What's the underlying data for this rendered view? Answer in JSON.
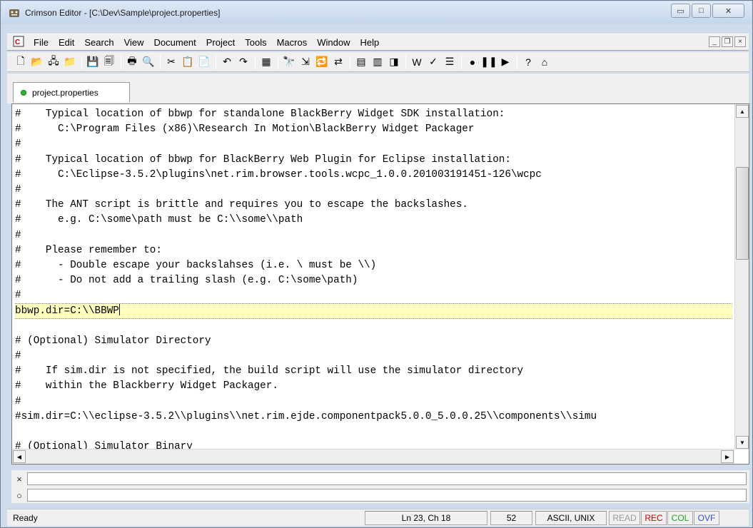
{
  "window": {
    "title": "Crimson Editor - [C:\\Dev\\Sample\\project.properties]",
    "controls": {
      "minimize": "▭",
      "maximize": "□",
      "close": "✕"
    }
  },
  "menubar": {
    "items": [
      "File",
      "Edit",
      "Search",
      "View",
      "Document",
      "Project",
      "Tools",
      "Macros",
      "Window",
      "Help"
    ],
    "mdi": {
      "minimize": "_",
      "restore": "❐",
      "close": "×"
    }
  },
  "toolbar": {
    "buttons": [
      {
        "name": "new-file",
        "glyph": "🗋"
      },
      {
        "name": "open-file",
        "glyph": "📂"
      },
      {
        "name": "open-remote",
        "glyph": "🖧"
      },
      {
        "name": "open-folder",
        "glyph": "📁"
      },
      {
        "sep": true
      },
      {
        "name": "save",
        "glyph": "💾"
      },
      {
        "name": "save-all",
        "glyph": "🗐"
      },
      {
        "sep": true
      },
      {
        "name": "print",
        "glyph": "🖶"
      },
      {
        "name": "print-preview",
        "glyph": "🔍"
      },
      {
        "sep": true
      },
      {
        "name": "cut",
        "glyph": "✂"
      },
      {
        "name": "copy",
        "glyph": "📋"
      },
      {
        "name": "paste",
        "glyph": "📄"
      },
      {
        "sep": true
      },
      {
        "name": "undo",
        "glyph": "↶"
      },
      {
        "name": "redo",
        "glyph": "↷"
      },
      {
        "sep": true
      },
      {
        "name": "column-mode",
        "glyph": "▦"
      },
      {
        "sep": true
      },
      {
        "name": "find",
        "glyph": "🔭"
      },
      {
        "name": "find-next",
        "glyph": "⇲"
      },
      {
        "name": "replace",
        "glyph": "🔁"
      },
      {
        "name": "replace-next",
        "glyph": "⇄"
      },
      {
        "sep": true
      },
      {
        "name": "toggle-output",
        "glyph": "▤"
      },
      {
        "name": "toggle-tabs",
        "glyph": "▥"
      },
      {
        "name": "toggle-directory",
        "glyph": "◨"
      },
      {
        "sep": true
      },
      {
        "name": "word-wrap",
        "glyph": "W"
      },
      {
        "name": "spell-check",
        "glyph": "✓"
      },
      {
        "name": "line-numbers",
        "glyph": "☰"
      },
      {
        "sep": true
      },
      {
        "name": "record-macro",
        "glyph": "●"
      },
      {
        "name": "pause-macro",
        "glyph": "❚❚"
      },
      {
        "name": "play-macro",
        "glyph": "▶"
      },
      {
        "sep": true
      },
      {
        "name": "help",
        "glyph": "?"
      },
      {
        "name": "home",
        "glyph": "⌂"
      }
    ]
  },
  "tab": {
    "label": "project.properties"
  },
  "editor": {
    "lines": [
      "#    Typical location of bbwp for standalone BlackBerry Widget SDK installation:",
      "#      C:\\Program Files (x86)\\Research In Motion\\BlackBerry Widget Packager",
      "#",
      "#    Typical location of bbwp for BlackBerry Web Plugin for Eclipse installation:",
      "#      C:\\Eclipse-3.5.2\\plugins\\net.rim.browser.tools.wcpc_1.0.0.201003191451-126\\wcpc",
      "#",
      "#    The ANT script is brittle and requires you to escape the backslashes.",
      "#      e.g. C:\\some\\path must be C:\\\\some\\\\path",
      "#",
      "#    Please remember to:",
      "#      - Double escape your backslahses (i.e. \\ must be \\\\)",
      "#      - Do not add a trailing slash (e.g. C:\\some\\path)",
      "#",
      "bbwp.dir=C:\\\\BBWP",
      "",
      "# (Optional) Simulator Directory",
      "#",
      "#    If sim.dir is not specified, the build script will use the simulator directory",
      "#    within the Blackberry Widget Packager.",
      "#",
      "#sim.dir=C:\\\\eclipse-3.5.2\\\\plugins\\\\net.rim.ejde.componentpack5.0.0_5.0.0.25\\\\components\\\\simu",
      "",
      "# (Optional) Simulator Binary"
    ],
    "current_line_index": 13
  },
  "panes": {
    "output_label": "×",
    "command_label": "○"
  },
  "status": {
    "ready": "Ready",
    "position": "Ln 23, Ch 18",
    "column": "52",
    "encoding": "ASCII, UNIX",
    "flags": {
      "read": "READ",
      "rec": "REC",
      "col": "COL",
      "ovr": "OVF"
    }
  }
}
